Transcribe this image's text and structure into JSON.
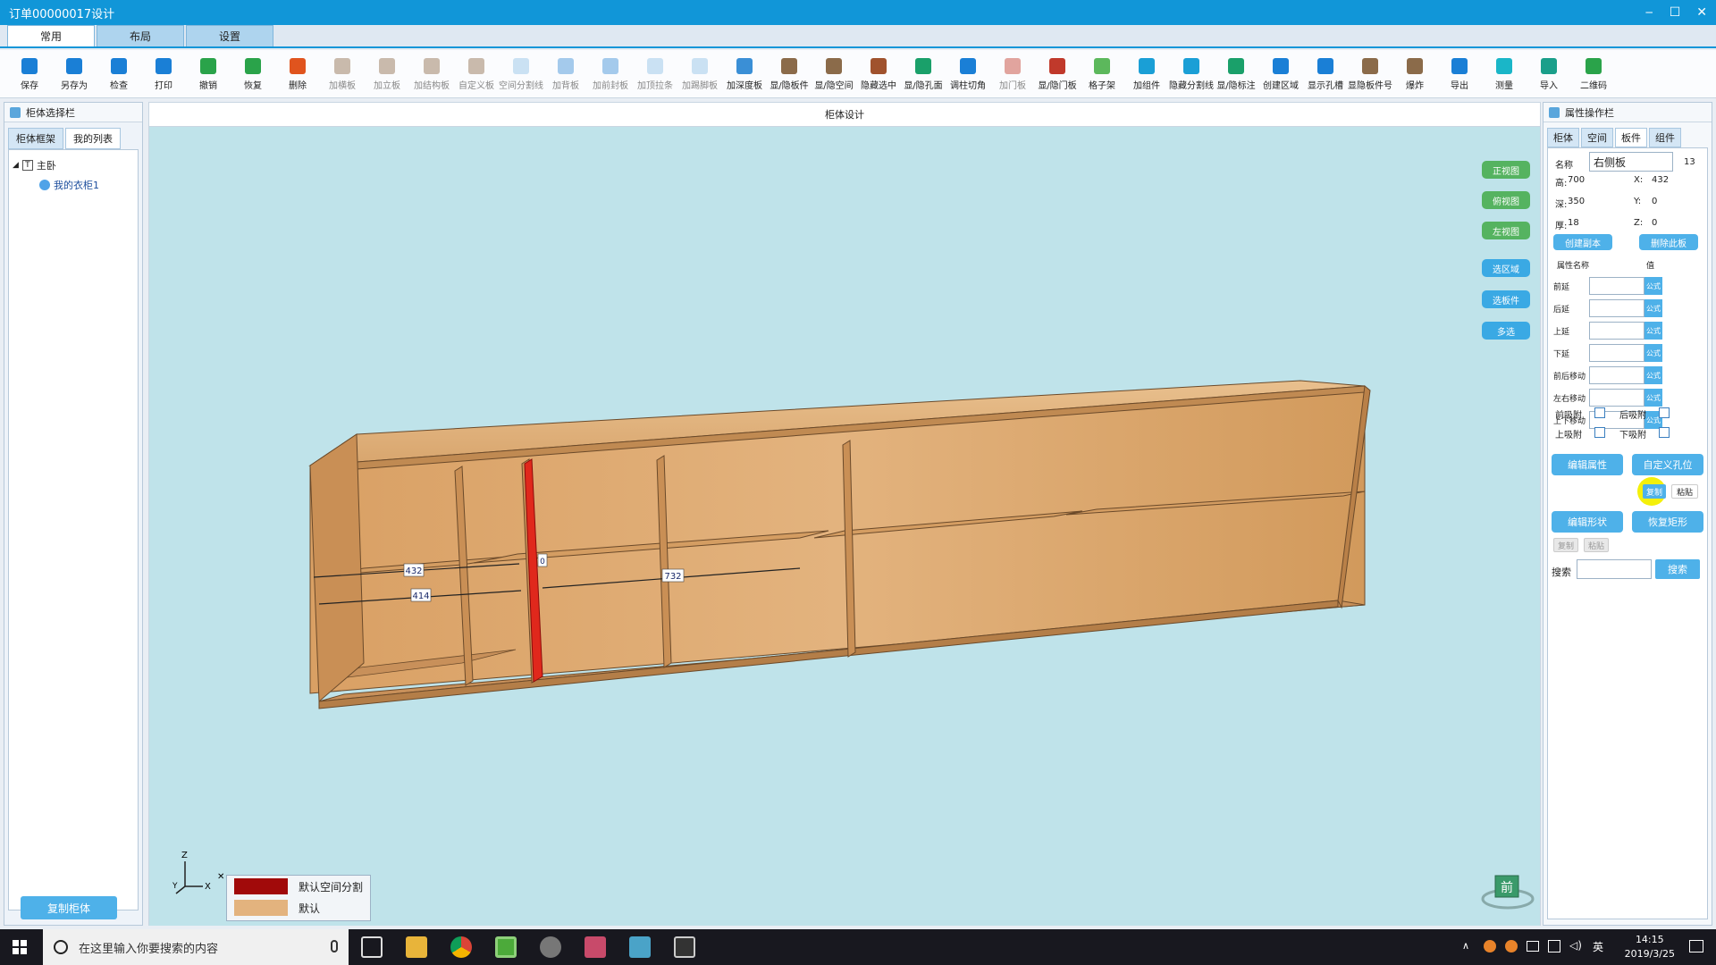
{
  "window": {
    "title": "订单00000017设计",
    "minimize": "‒",
    "maximize": "☐",
    "close": "✕"
  },
  "ribbon_tabs": [
    "常用",
    "布局",
    "设置"
  ],
  "toolbar": [
    {
      "label": "保存",
      "color": "#1a7fd6",
      "disabled": false
    },
    {
      "label": "另存为",
      "color": "#1a7fd6",
      "disabled": false
    },
    {
      "label": "检查",
      "color": "#1a7fd6",
      "disabled": false
    },
    {
      "label": "打印",
      "color": "#1a7fd6",
      "disabled": false
    },
    {
      "label": "撤销",
      "color": "#2aa34a",
      "disabled": false
    },
    {
      "label": "恢复",
      "color": "#2aa34a",
      "disabled": false
    },
    {
      "label": "删除",
      "color": "#e0541e",
      "disabled": false
    },
    {
      "label": "加横板",
      "color": "#8b6b4a",
      "disabled": true
    },
    {
      "label": "加立板",
      "color": "#8b6b4a",
      "disabled": true
    },
    {
      "label": "加结构板",
      "color": "#8b6b4a",
      "disabled": true
    },
    {
      "label": "自定义板",
      "color": "#8b6b4a",
      "disabled": true
    },
    {
      "label": "空间分割线",
      "color": "#8fc0e6",
      "disabled": true
    },
    {
      "label": "加背板",
      "color": "#3a8fd6",
      "disabled": true
    },
    {
      "label": "加前封板",
      "color": "#3a8fd6",
      "disabled": true
    },
    {
      "label": "加顶拉条",
      "color": "#8fc0e6",
      "disabled": true
    },
    {
      "label": "加踢脚板",
      "color": "#8fc0e6",
      "disabled": true
    },
    {
      "label": "加深度板",
      "color": "#3a8fd6",
      "disabled": false
    },
    {
      "label": "显/隐板件",
      "color": "#8b6b4a",
      "disabled": false
    },
    {
      "label": "显/隐空间",
      "color": "#8b6b4a",
      "disabled": false
    },
    {
      "label": "隐藏选中",
      "color": "#a0522d",
      "disabled": false
    },
    {
      "label": "显/隐孔面",
      "color": "#1aa06a",
      "disabled": false
    },
    {
      "label": "调柱切角",
      "color": "#1a7fd6",
      "disabled": false
    },
    {
      "label": "加门板",
      "color": "#c0392b",
      "disabled": true
    },
    {
      "label": "显/隐门板",
      "color": "#c0392b",
      "disabled": false
    },
    {
      "label": "格子架",
      "color": "#5cb85c",
      "disabled": false
    },
    {
      "label": "加组件",
      "color": "#1a9fd6",
      "disabled": false
    },
    {
      "label": "隐藏分割线",
      "color": "#1a9fd6",
      "disabled": false
    },
    {
      "label": "显/隐标注",
      "color": "#1aa06a",
      "disabled": false
    },
    {
      "label": "创建区域",
      "color": "#1a7fd6",
      "disabled": false
    },
    {
      "label": "显示孔槽",
      "color": "#1a7fd6",
      "disabled": false
    },
    {
      "label": "显隐板件号",
      "color": "#8b6b4a",
      "disabled": false
    },
    {
      "label": "爆炸",
      "color": "#8b6b4a",
      "disabled": false
    },
    {
      "label": "导出",
      "color": "#1a7fd6",
      "disabled": false
    },
    {
      "label": "测量",
      "color": "#1ab6c8",
      "disabled": false
    },
    {
      "label": "导入",
      "color": "#1a9f8a",
      "disabled": false
    },
    {
      "label": "二维码",
      "color": "#2aa34a",
      "disabled": false
    }
  ],
  "left_panel": {
    "title": "柜体选择栏",
    "tabs": [
      "柜体框架",
      "我的列表"
    ],
    "tree_root": "主卧",
    "tree_child": "我的衣柜1",
    "copy_button": "复制柜体"
  },
  "viewport": {
    "title": "柜体设计",
    "view_buttons": [
      "正视图",
      "俯视图",
      "左视图"
    ],
    "tool_buttons": [
      "选区域",
      "选板件",
      "多选"
    ],
    "dims": {
      "d432": "432",
      "d414": "414",
      "d732": "732",
      "d0": "0"
    },
    "axes": {
      "z": "Z",
      "x": "X",
      "y": "Y",
      "close": "✕"
    },
    "front_label": "前"
  },
  "legend": [
    {
      "color": "#a10a0a",
      "label": "默认空间分割"
    },
    {
      "color": "#e3b37e",
      "label": "默认"
    }
  ],
  "right_panel": {
    "title": "属性操作栏",
    "tabs": [
      "柜体",
      "空间",
      "板件",
      "组件"
    ],
    "name_label": "名称",
    "name_value": "右侧板",
    "id_value": "13",
    "height_label": "高:",
    "height": "700",
    "depth_label": "深:",
    "depth": "350",
    "thick_label": "厚:",
    "thickness": "18",
    "x_label": "X:",
    "x": "432",
    "y_label": "Y:",
    "y": "0",
    "z_label": "Z:",
    "z": "0",
    "btn_create_copy": "创建副本",
    "btn_delete_board": "删除此板",
    "attr_header": "属性名称",
    "value_header": "值",
    "attrs": [
      "前延",
      "后延",
      "上延",
      "下延",
      "前后移动",
      "左右移动",
      "上下移动"
    ],
    "formula": "公式",
    "snaps": [
      "前吸附",
      "后吸附",
      "上吸附",
      "下吸附"
    ],
    "btn_edit_attr": "编辑属性",
    "btn_custom_hole": "自定义孔位",
    "btn_copy": "复制",
    "btn_paste": "粘贴",
    "btn_edit_shape": "编辑形状",
    "btn_restore_rect": "恢复矩形",
    "btn_copy2": "复制",
    "btn_paste2": "粘贴",
    "search_label": "搜索",
    "search_button": "搜索"
  },
  "taskbar": {
    "search_placeholder": "在这里输入你要搜索的内容",
    "time": "14:15",
    "date": "2019/3/25",
    "ime": "英"
  }
}
